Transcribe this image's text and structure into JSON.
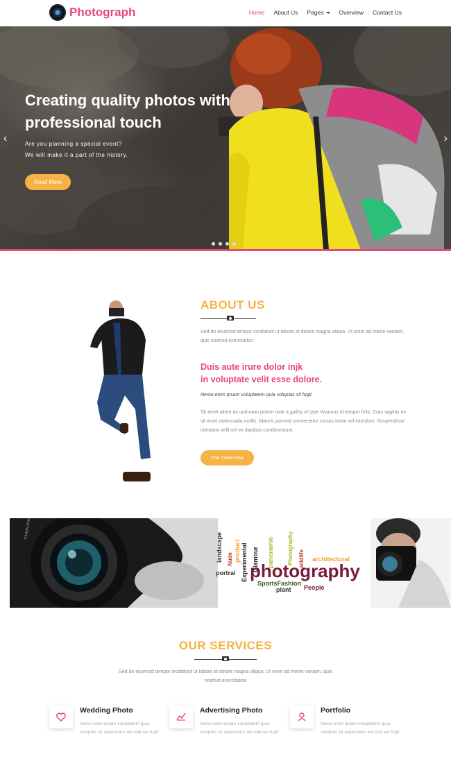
{
  "header": {
    "logo_text": "Photograph",
    "nav": [
      {
        "label": "Home",
        "active": true
      },
      {
        "label": "About Us"
      },
      {
        "label": "Pages"
      },
      {
        "label": "Overview"
      },
      {
        "label": "Contact Us"
      }
    ]
  },
  "hero": {
    "title_line1": "Creating quality photos with",
    "title_line2": "professional touch",
    "sub_line1": "Are you planning a special event?",
    "sub_line2": "We will make it a part of the history.",
    "button": "Read More",
    "slide_count": 4
  },
  "about": {
    "title": "ABOUT US",
    "paragraph": "Sed do eiusmod tempor incididunt ut labore et dolore magna aliqua. Ut enim ad minim veniam, quis nostrud exercitation",
    "headline_line1": "Duis aute irure dolor injk",
    "headline_line2": "in voluptate velit esse dolore.",
    "italic": "Nemo enim ipsam voluptatem quia voluptas sit fugit",
    "paragraph2": "Sit amet when an unknown printer took a galley of type.Vivamus id tempor felis. Cras sagittis mi sit amet malesuada mollis. Mauris porroint connectetur cursus tortor vel interdum. Suspendisse interdum velit vel ex dapibus condimentum.",
    "button": "Our Overview"
  },
  "banner": {
    "lens_text": "CANON ZOOM LENS EF",
    "words": [
      "landscape",
      "Nude",
      "product",
      "Experimental",
      "Glamour",
      "panoramic",
      "Photography",
      "wildlife",
      "architectural",
      "portrai",
      "photography",
      "SportsFashion",
      "plant",
      "People"
    ]
  },
  "services": {
    "title": "OUR SERVICES",
    "paragraph": "Sed do eiusmod tempor incididunt ut labore et dolore magna aliqua. Ut enim ad minim veniam, quis nostrud exercitation",
    "items": [
      {
        "name": "Wedding Photo",
        "desc": "Nemo enim ipsam voluptatem quia voluptas sit aspernatur aut odit aut fugit",
        "icon": "heart-icon"
      },
      {
        "name": "Advertising Photo",
        "desc": "Nemo enim ipsam voluptatem quia voluptas sit aspernatur aut odit aut fugit",
        "icon": "chart-icon"
      },
      {
        "name": "Portfolio",
        "desc": "Nemo enim ipsam voluptatem quia voluptas sit aspernatur aut odit aut fugit",
        "icon": "user-icon"
      }
    ]
  },
  "colors": {
    "accent": "#e8467c",
    "secondary": "#f6b244"
  }
}
